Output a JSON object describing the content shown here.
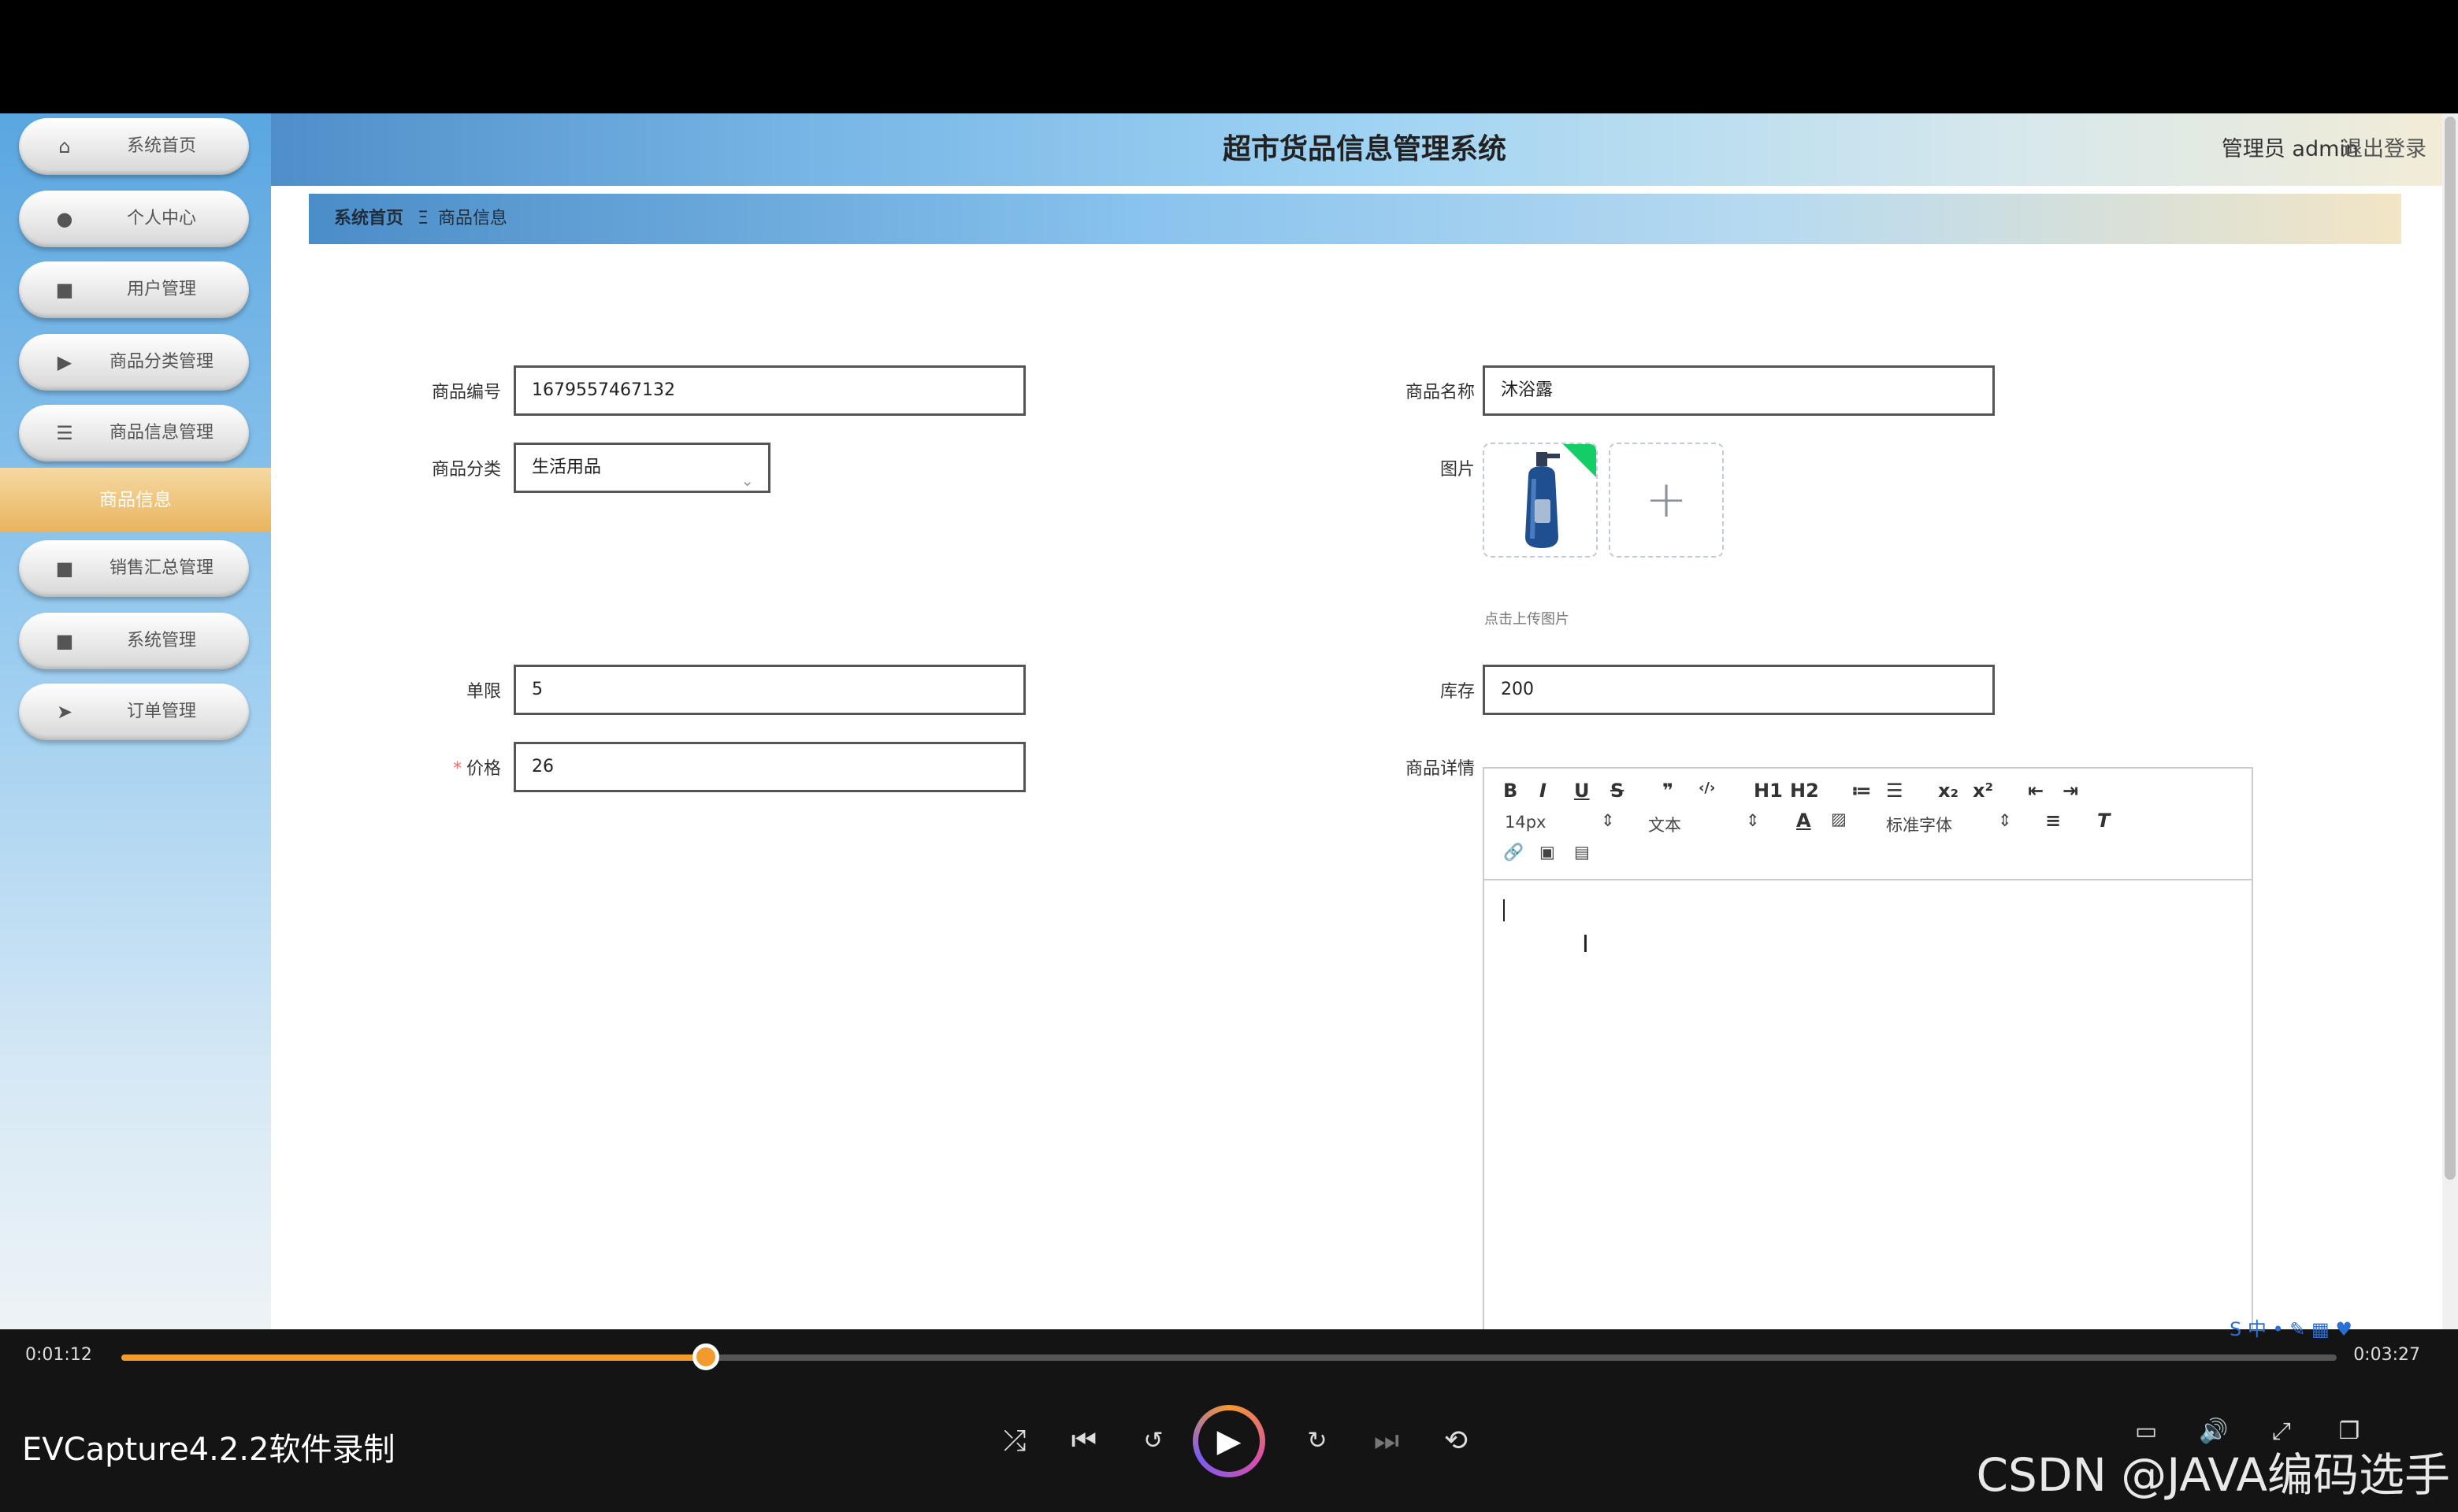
{
  "app": {
    "title": "超市货品信息管理系统",
    "user": "管理员 admin",
    "logout": "退出登录"
  },
  "sidebar": {
    "items": [
      {
        "label": "系统首页",
        "icon": "home-icon",
        "glyph": "⌂"
      },
      {
        "label": "个人中心",
        "icon": "user-icon",
        "glyph": "●"
      },
      {
        "label": "用户管理",
        "icon": "grid-icon",
        "glyph": "■"
      },
      {
        "label": "商品分类管理",
        "icon": "video-icon",
        "glyph": "▶"
      },
      {
        "label": "商品信息管理",
        "icon": "list-icon",
        "glyph": "☰"
      },
      {
        "label": "销售汇总管理",
        "icon": "grid-icon",
        "glyph": "■"
      },
      {
        "label": "系统管理",
        "icon": "grid-icon",
        "glyph": "■"
      },
      {
        "label": "订单管理",
        "icon": "send-icon",
        "glyph": "➤"
      }
    ],
    "active_sub": "商品信息"
  },
  "breadcrumb": {
    "home": "系统首页",
    "sep": "Ξ",
    "current": "商品信息"
  },
  "form": {
    "code_label": "商品编号",
    "code_value": "1679557467132",
    "name_label": "商品名称",
    "name_value": "沐浴露",
    "category_label": "商品分类",
    "category_value": "生活用品",
    "image_label": "图片",
    "image_hint": "点击上传图片",
    "limit_label": "单限",
    "limit_value": "5",
    "stock_label": "库存",
    "stock_value": "200",
    "price_label": "价格",
    "price_value": "26",
    "detail_label": "商品详情"
  },
  "editor": {
    "size": "14px",
    "format": "文本",
    "font": "标准字体",
    "buttons": [
      "B",
      "I",
      "U",
      "S",
      "❞",
      "‹/›",
      "H1",
      "H2",
      "≔",
      "☰",
      "x₂",
      "x²",
      "⇤",
      "⇥"
    ]
  },
  "player": {
    "elapsed": "0:01:12",
    "total": "0:03:27",
    "progress": 0.264,
    "brand": "EVCapture4.2.2软件录制",
    "watermark": "CSDN @JAVA编码选手"
  }
}
